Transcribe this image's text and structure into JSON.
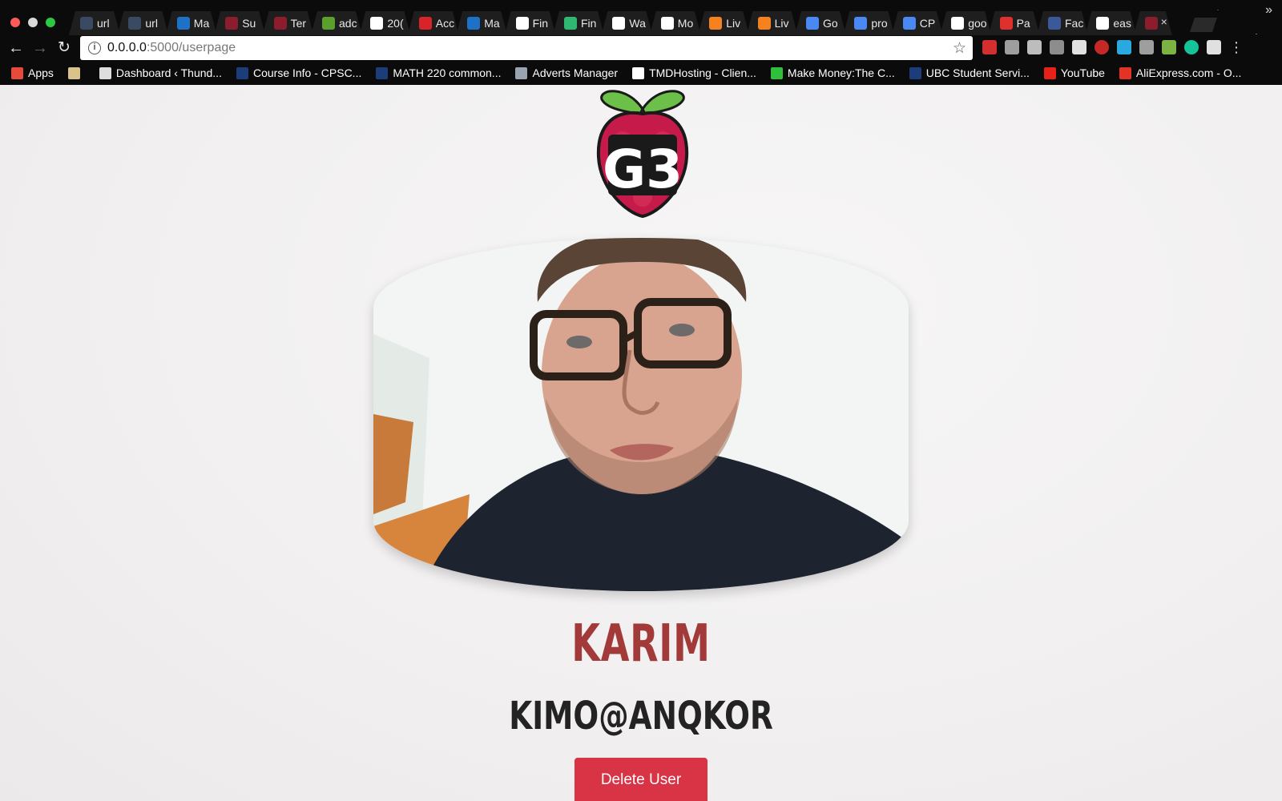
{
  "browser": {
    "tabs": [
      {
        "label": "url",
        "fav_color": "#3b4a63",
        "icon": "terminal-icon"
      },
      {
        "label": "url",
        "fav_color": "#3b4a63",
        "icon": "terminal-icon"
      },
      {
        "label": "Ma",
        "fav_color": "#1d72c7",
        "icon": "outlook-icon"
      },
      {
        "label": "Su",
        "fav_color": "#8b1d2c",
        "icon": "g3-icon"
      },
      {
        "label": "Ter",
        "fav_color": "#8b1d2c",
        "icon": "g3-icon"
      },
      {
        "label": "adc",
        "fav_color": "#5aa02c",
        "icon": "android-icon"
      },
      {
        "label": "20(",
        "fav_color": "#ffffff",
        "icon": "google-icon"
      },
      {
        "label": "Acc",
        "fav_color": "#d8232a",
        "icon": "s-icon"
      },
      {
        "label": "Ma",
        "fav_color": "#1d72c7",
        "icon": "outlook-icon"
      },
      {
        "label": "Fin",
        "fav_color": "#ffffff",
        "icon": "google-icon"
      },
      {
        "label": "Fin",
        "fav_color": "#2eb872",
        "icon": "green-icon"
      },
      {
        "label": "Wa",
        "fav_color": "#ffffff",
        "icon": "r7-icon"
      },
      {
        "label": "Mo",
        "fav_color": "#ffffff",
        "icon": "medium-icon"
      },
      {
        "label": "Liv",
        "fav_color": "#f5811f",
        "icon": "live-icon"
      },
      {
        "label": "Liv",
        "fav_color": "#f5811f",
        "icon": "live-icon"
      },
      {
        "label": "Go",
        "fav_color": "#4a89f3",
        "icon": "docs-icon"
      },
      {
        "label": "pro",
        "fav_color": "#4a89f3",
        "icon": "docs-icon"
      },
      {
        "label": "CP",
        "fav_color": "#4a89f3",
        "icon": "docs-icon"
      },
      {
        "label": "goo",
        "fav_color": "#ffffff",
        "icon": "google-icon"
      },
      {
        "label": "Pa",
        "fav_color": "#e0302b",
        "icon": "doordash-icon"
      },
      {
        "label": "Fac",
        "fav_color": "#3b5998",
        "icon": "facebook-icon"
      },
      {
        "label": "eas",
        "fav_color": "#ffffff",
        "icon": "google-icon"
      },
      {
        "label": "",
        "fav_color": "#8b1d2c",
        "icon": "g3-icon"
      }
    ],
    "url_host": "0.0.0.0",
    "url_path": ":5000/userpage",
    "bookmarks": [
      {
        "label": "Apps",
        "color": "#e64a3a"
      },
      {
        "label": "",
        "color": "#d9c38a"
      },
      {
        "label": "Dashboard ‹ Thund...",
        "color": "#dddddd"
      },
      {
        "label": "Course Info - CPSC...",
        "color": "#1c3d7a"
      },
      {
        "label": "MATH 220 common...",
        "color": "#1c3d7a"
      },
      {
        "label": "Adverts Manager",
        "color": "#9aa3b0"
      },
      {
        "label": "TMDHosting - Clien...",
        "color": "#ffffff"
      },
      {
        "label": "Make Money:The C...",
        "color": "#2fbf3a"
      },
      {
        "label": "UBC Student Servi...",
        "color": "#1c3d7a"
      },
      {
        "label": "YouTube",
        "color": "#e62117"
      },
      {
        "label": "AliExpress.com - O...",
        "color": "#e43225"
      }
    ]
  },
  "user": {
    "name": "KARIM",
    "username": "KIMO@ANQKOR"
  },
  "logo_text": "G3",
  "actions": {
    "delete_label": "Delete User"
  },
  "colors": {
    "name": "#a23a3a",
    "button": "#d93346",
    "raspberry": "#c51a4a",
    "leaf": "#6cc04a"
  }
}
